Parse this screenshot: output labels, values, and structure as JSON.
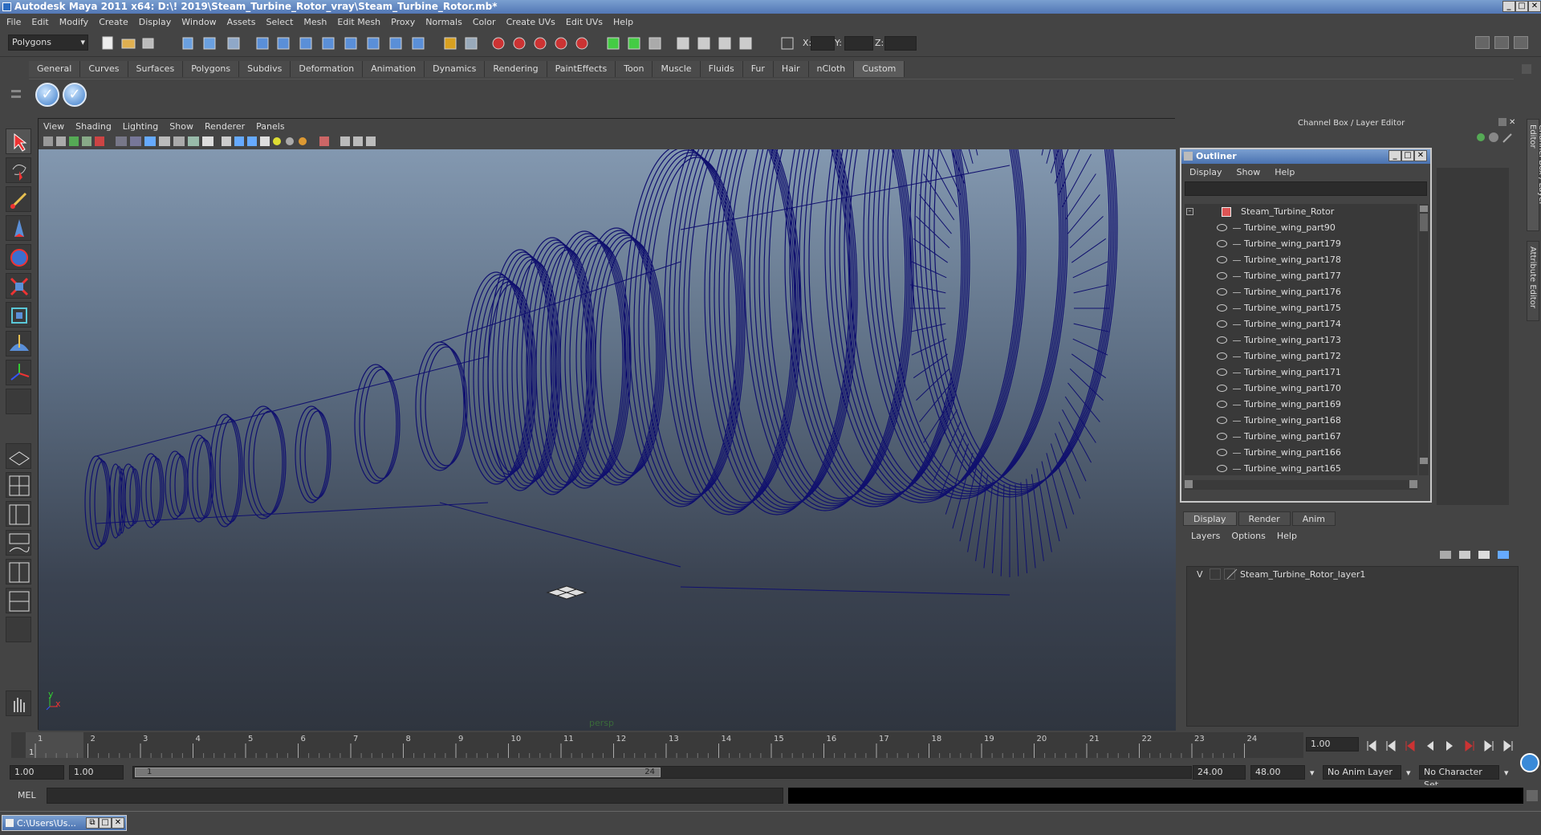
{
  "window": {
    "title": "Autodesk Maya 2011 x64: D:\\! 2019\\Steam_Turbine_Rotor_vray\\Steam_Turbine_Rotor.mb*"
  },
  "menubar": {
    "items": [
      "File",
      "Edit",
      "Modify",
      "Create",
      "Display",
      "Window",
      "Assets",
      "Select",
      "Mesh",
      "Edit Mesh",
      "Proxy",
      "Normals",
      "Color",
      "Create UVs",
      "Edit UVs",
      "Help"
    ]
  },
  "status": {
    "mode": "Polygons",
    "x_label": "X:",
    "y_label": "Y:",
    "z_label": "Z:"
  },
  "shelf": {
    "tabs": [
      "General",
      "Curves",
      "Surfaces",
      "Polygons",
      "Subdivs",
      "Deformation",
      "Animation",
      "Dynamics",
      "Rendering",
      "PaintEffects",
      "Toon",
      "Muscle",
      "Fluids",
      "Fur",
      "Hair",
      "nCloth",
      "Custom"
    ],
    "active_tab": "Custom"
  },
  "viewport": {
    "menu": [
      "View",
      "Shading",
      "Lighting",
      "Show",
      "Renderer",
      "Panels"
    ],
    "camera_label": "persp",
    "axis_y": "y",
    "axis_x": "x",
    "wire_color": "#10106e"
  },
  "right_panel": {
    "header": "Channel Box / Layer Editor",
    "side_tab_1": "Channel Box / Layer Editor",
    "side_tab_2": "Attribute Editor"
  },
  "outliner": {
    "title": "Outliner",
    "menu": [
      "Display",
      "Show",
      "Help"
    ],
    "root": "Steam_Turbine_Rotor",
    "items": [
      "Turbine_wing_part90",
      "Turbine_wing_part179",
      "Turbine_wing_part178",
      "Turbine_wing_part177",
      "Turbine_wing_part176",
      "Turbine_wing_part175",
      "Turbine_wing_part174",
      "Turbine_wing_part173",
      "Turbine_wing_part172",
      "Turbine_wing_part171",
      "Turbine_wing_part170",
      "Turbine_wing_part169",
      "Turbine_wing_part168",
      "Turbine_wing_part167",
      "Turbine_wing_part166",
      "Turbine_wing_part165"
    ]
  },
  "layer_editor": {
    "tabs": [
      "Display",
      "Render",
      "Anim"
    ],
    "active_tab": "Display",
    "menu": [
      "Layers",
      "Options",
      "Help"
    ],
    "layer_visibility": "V",
    "layer_name": "Steam_Turbine_Rotor_layer1"
  },
  "timeline": {
    "ticks": [
      "1",
      "2",
      "3",
      "4",
      "5",
      "6",
      "7",
      "8",
      "9",
      "10",
      "11",
      "12",
      "13",
      "14",
      "15",
      "16",
      "17",
      "18",
      "19",
      "20",
      "21",
      "22",
      "23",
      "24"
    ],
    "current_frame_label": "1",
    "current_time": "1.00"
  },
  "range": {
    "start_time": "1.00",
    "playback_start": "1.00",
    "slider_start": "1",
    "slider_end": "24",
    "playback_end": "24.00",
    "end_time": "48.00",
    "anim_layer": "No Anim Layer",
    "character_set": "No Character Set"
  },
  "cmdline": {
    "label": "MEL"
  },
  "taskbar": {
    "item": "C:\\Users\\Us..."
  }
}
